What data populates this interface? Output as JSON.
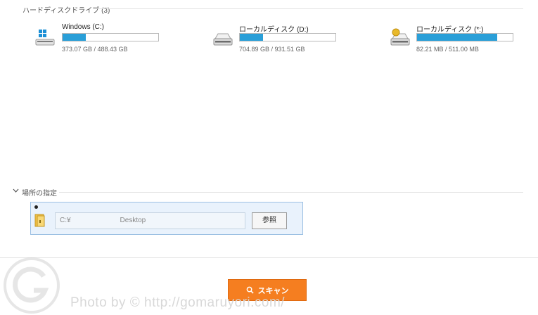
{
  "hard_disk": {
    "title": "ハードディスクドライブ (3)",
    "drives": [
      {
        "name": "Windows (C:)",
        "size": "373.07 GB / 488.43 GB",
        "used_fraction": 0.24,
        "icon": "windows-drive-icon"
      },
      {
        "name": "ローカルディスク (D:)",
        "size": "704.89 GB / 931.51 GB",
        "used_fraction": 0.24,
        "icon": "hard-drive-icon"
      },
      {
        "name": "ローカルディスク (*:)",
        "size": "82.21 MB / 511.00 MB",
        "used_fraction": 0.84,
        "icon": "locked-drive-icon"
      }
    ]
  },
  "location": {
    "title": "場所の指定",
    "path_value": "C:¥　　　　　　　Desktop",
    "browse_label": "参照"
  },
  "scan": {
    "label": "スキャン"
  },
  "watermark": {
    "text": "Photo by © http://gomaruyori.com/"
  },
  "colors": {
    "accent": "#f57e20",
    "bar_fill": "#2a9fd8",
    "panel_bg": "#e9f2fc"
  }
}
